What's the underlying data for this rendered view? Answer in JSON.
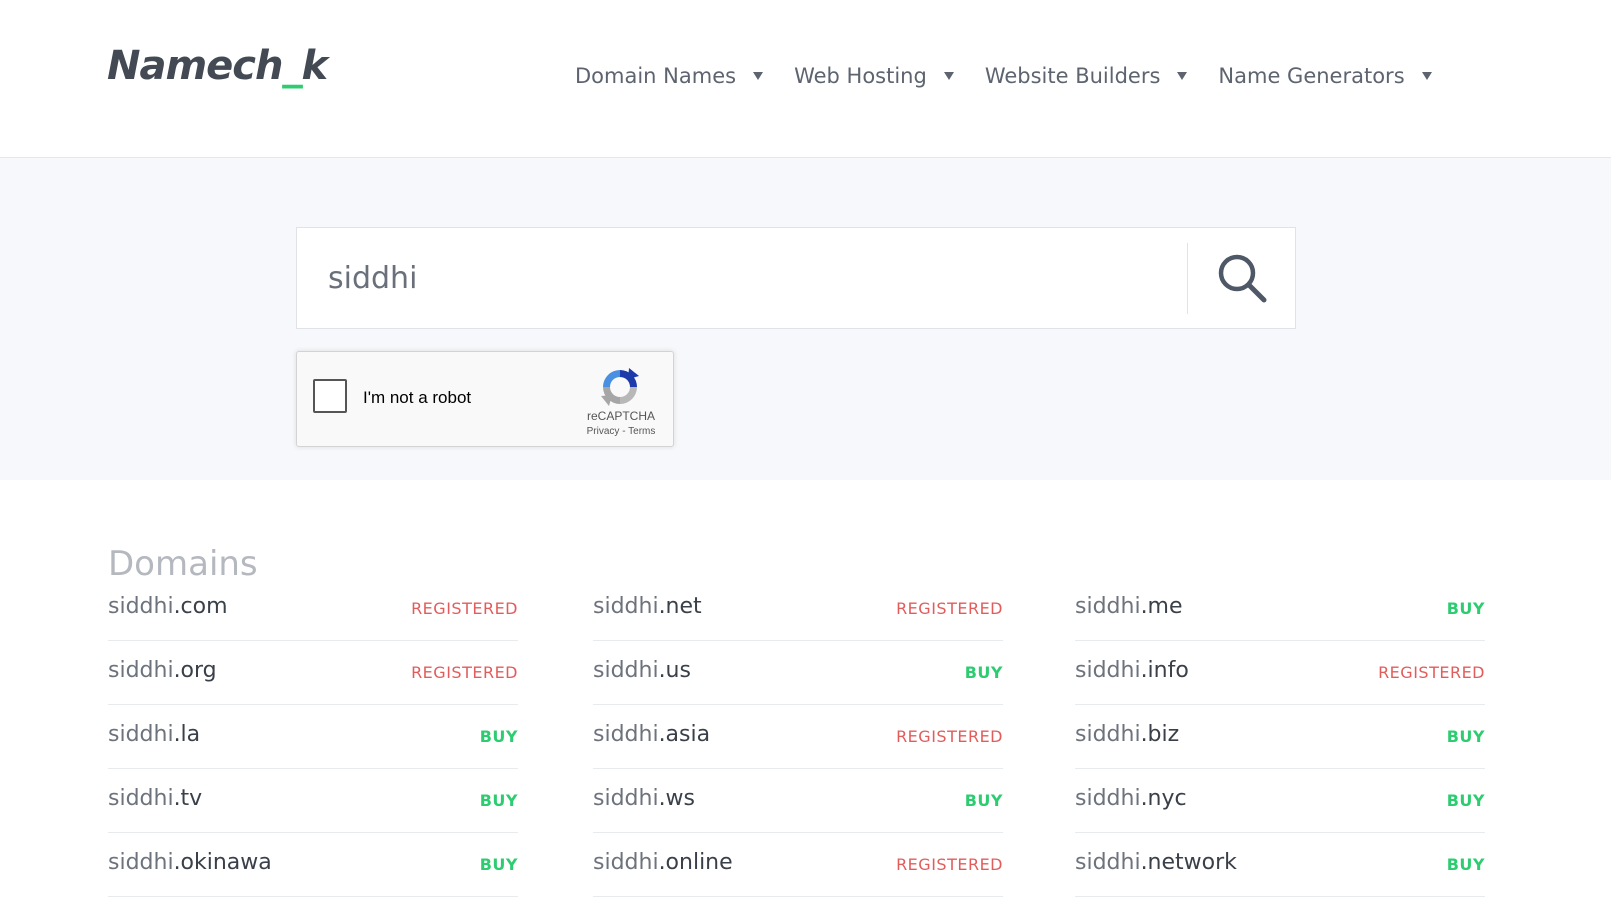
{
  "header": {
    "logo_main": "Namech",
    "logo_underscore": "_",
    "logo_end": "k",
    "nav": [
      {
        "label": "Domain Names"
      },
      {
        "label": "Web Hosting"
      },
      {
        "label": "Website Builders"
      },
      {
        "label": "Name Generators"
      }
    ]
  },
  "search": {
    "value": "siddhi",
    "button_icon": "search-icon"
  },
  "captcha": {
    "label": "I'm not a robot",
    "brand": "reCAPTCHA",
    "privacy": "Privacy",
    "separator": " - ",
    "terms": "Terms"
  },
  "results": {
    "title": "Domains",
    "columns": [
      [
        {
          "base": "siddhi",
          "tld": ".com",
          "status": "REGISTERED",
          "available": false
        },
        {
          "base": "siddhi",
          "tld": ".org",
          "status": "REGISTERED",
          "available": false
        },
        {
          "base": "siddhi",
          "tld": ".la",
          "status": "BUY",
          "available": true
        },
        {
          "base": "siddhi",
          "tld": ".tv",
          "status": "BUY",
          "available": true
        },
        {
          "base": "siddhi",
          "tld": ".okinawa",
          "status": "BUY",
          "available": true
        }
      ],
      [
        {
          "base": "siddhi",
          "tld": ".net",
          "status": "REGISTERED",
          "available": false
        },
        {
          "base": "siddhi",
          "tld": ".us",
          "status": "BUY",
          "available": true
        },
        {
          "base": "siddhi",
          "tld": ".asia",
          "status": "REGISTERED",
          "available": false
        },
        {
          "base": "siddhi",
          "tld": ".ws",
          "status": "BUY",
          "available": true
        },
        {
          "base": "siddhi",
          "tld": ".online",
          "status": "REGISTERED",
          "available": false
        }
      ],
      [
        {
          "base": "siddhi",
          "tld": ".me",
          "status": "BUY",
          "available": true
        },
        {
          "base": "siddhi",
          "tld": ".info",
          "status": "REGISTERED",
          "available": false
        },
        {
          "base": "siddhi",
          "tld": ".biz",
          "status": "BUY",
          "available": true
        },
        {
          "base": "siddhi",
          "tld": ".nyc",
          "status": "BUY",
          "available": true
        },
        {
          "base": "siddhi",
          "tld": ".network",
          "status": "BUY",
          "available": true
        }
      ]
    ]
  },
  "colors": {
    "brand_green": "#2ecc71",
    "registered_red": "#e25c5c",
    "band_background": "#f6f8fb"
  }
}
